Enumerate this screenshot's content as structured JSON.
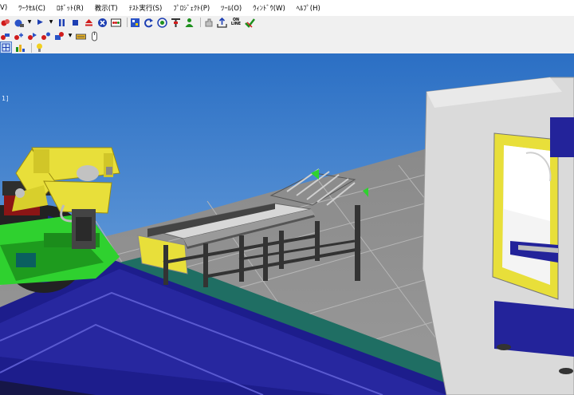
{
  "menu": {
    "items": [
      "V)",
      "ﾜｰｸｾﾙ(C)",
      "ﾛﾎﾞｯﾄ(R)",
      "教示(T)",
      "ﾃｽﾄ実行(S)",
      "ﾌﾟﾛｼﾞｪｸﾄ(P)",
      "ﾂｰﾙ(O)",
      "ｳｨﾝﾄﾞｳ(W)",
      "ﾍﾙﾌﾟ(H)"
    ]
  },
  "toolbar": {
    "online_label_top": "ON",
    "online_label_bottom": "LINE"
  },
  "viewport": {
    "view_tag": "1]"
  },
  "colors": {
    "sky_top": "#2b6fc4",
    "sky_bottom": "#7fb0e3",
    "floor": "#8f8f8f",
    "robot_yellow": "#e8df3a",
    "base_green": "#2fd12f",
    "rail_blue": "#20209a",
    "rail_teal": "#1f6e63",
    "machine_gray": "#dadada"
  }
}
